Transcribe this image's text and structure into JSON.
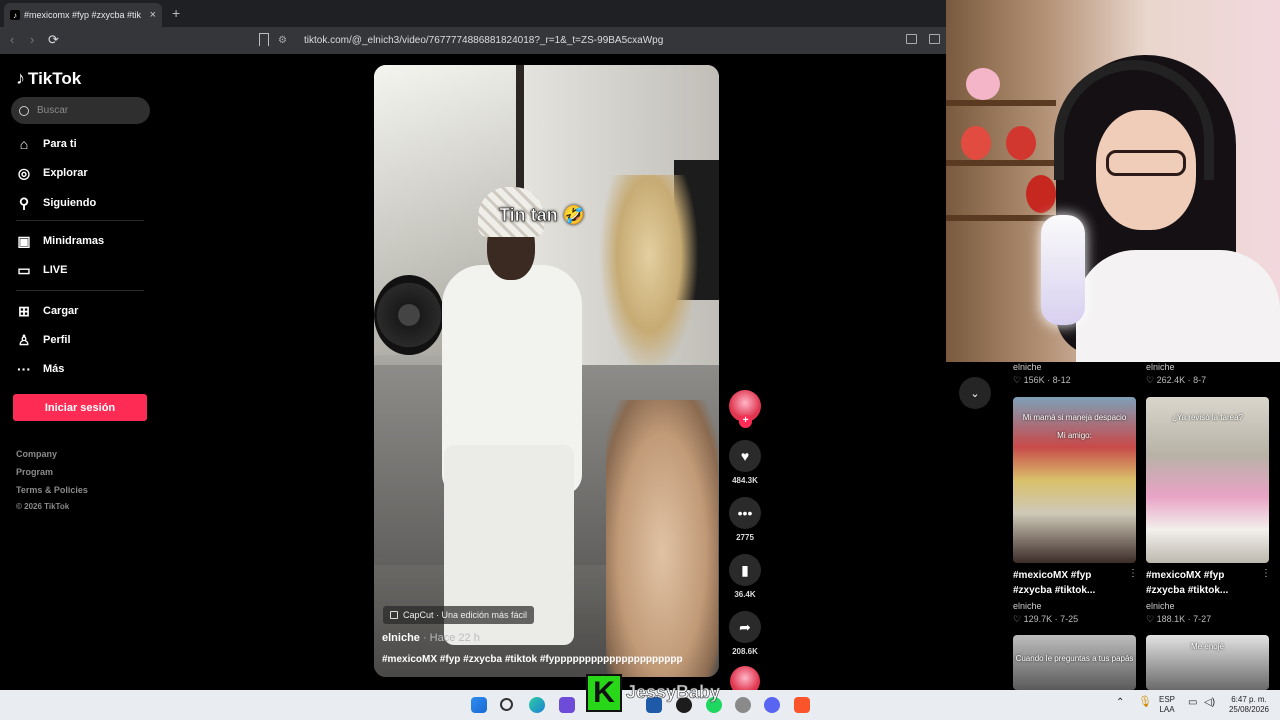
{
  "browser": {
    "tab_title": "#mexicomx #fyp #zxycba #tik",
    "tab_close": "×",
    "new_tab": "+",
    "url": "tiktok.com/@_elnich3/video/7677774886881824018?_r=1&_t=ZS-99BA5cxaWpg",
    "back": "‹",
    "forward": "›",
    "reload": "⟳"
  },
  "sidebar": {
    "logo": "TikTok",
    "search_placeholder": "Buscar",
    "items": [
      {
        "label": "Para ti",
        "icon": "home-icon"
      },
      {
        "label": "Explorar",
        "icon": "compass-icon"
      },
      {
        "label": "Siguiendo",
        "icon": "following-icon"
      },
      {
        "label": "Minidramas",
        "icon": "minidramas-icon"
      },
      {
        "label": "LIVE",
        "icon": "live-icon"
      },
      {
        "label": "Cargar",
        "icon": "upload-icon"
      },
      {
        "label": "Perfil",
        "icon": "profile-icon"
      },
      {
        "label": "Más",
        "icon": "more-icon"
      }
    ],
    "login_button": "Iniciar sesión",
    "footer": [
      "Company",
      "Program",
      "Terms & Policies",
      "© 2026 TikTok"
    ]
  },
  "video": {
    "caption_overlay": "Tin tan 🤣",
    "capcut_badge": "CapCut · Una edición más fácil",
    "author": "elniche",
    "age": " · Hace 22 h",
    "description": "#mexicoMX #fyp #zxycba #tiktok #fyppppppppppppppppppppp"
  },
  "actions": {
    "likes": "484.3K",
    "comments": "2775",
    "saves": "36.4K",
    "shares": "208.6K"
  },
  "recommendations": {
    "top_row": [
      {
        "author": "elniche",
        "likes": "156K",
        "date": "8-12"
      },
      {
        "author": "elniche",
        "likes": "262.4K",
        "date": "8-7"
      }
    ],
    "middle_row": [
      {
        "caption": "Mi mamá si maneja despacio",
        "caption2": "Mi amigo:",
        "title": "#mexicoMX #fyp #zxycba #tiktok...",
        "author": "elniche",
        "likes": "129.7K",
        "date": "7-25"
      },
      {
        "caption": "¿Ya revisó la tarea?",
        "title": "#mexicoMX #fyp #zxycba #tiktok...",
        "author": "elniche",
        "likes": "188.1K",
        "date": "7-27"
      }
    ],
    "bottom_row": [
      {
        "caption": "Cuando le preguntas a tus papás"
      },
      {
        "caption": "Me enojé"
      }
    ]
  },
  "overlay": {
    "k_logo": "K",
    "streamer_name": "JessyBaby"
  },
  "taskbar": {
    "lang": "ESP",
    "lang2": "LAA",
    "time": "6:47 p. m.",
    "date": "25/08/2026"
  },
  "colors": {
    "accent": "#fe2c55",
    "bg": "#000000",
    "taskbar": "#e9edf2"
  }
}
